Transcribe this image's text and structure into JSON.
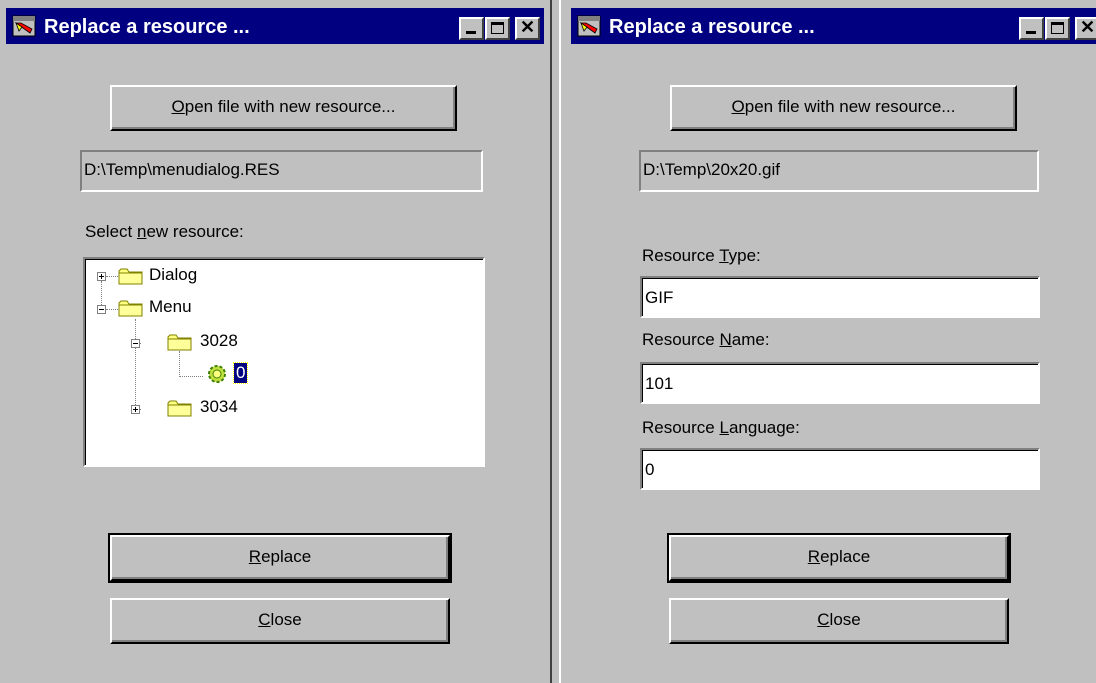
{
  "colors": {
    "face": "#c0c0c0",
    "titlebar": "#000080",
    "selection": "#000080",
    "folder": "#ffff80",
    "resource_icon": "#80c000"
  },
  "left_window": {
    "title": "Replace a resource ...",
    "open_button_label": "Open file with new resource...",
    "file_path": "D:\\Temp\\menudialog.RES",
    "select_label_pre": "Select ",
    "select_label_key": "n",
    "select_label_post": "ew resource:",
    "tree": {
      "dialog": "Dialog",
      "menu": "Menu",
      "menu_3028": "3028",
      "item_0": "0",
      "menu_3034": "3034"
    },
    "replace_label": "Replace",
    "close_label": "Close"
  },
  "right_window": {
    "title": "Replace a resource ...",
    "open_button_label": "Open file with new resource...",
    "file_path": "D:\\Temp\\20x20.gif",
    "type_label_pre": "Resource ",
    "type_label_key": "T",
    "type_label_post": "ype:",
    "type_value": "GIF",
    "name_label_pre": "Resource ",
    "name_label_key": "N",
    "name_label_post": "ame:",
    "name_value": "101",
    "lang_label_pre": "Resource ",
    "lang_label_key": "L",
    "lang_label_post": "anguage:",
    "lang_value": "0",
    "replace_label": "Replace",
    "close_label": "Close"
  }
}
